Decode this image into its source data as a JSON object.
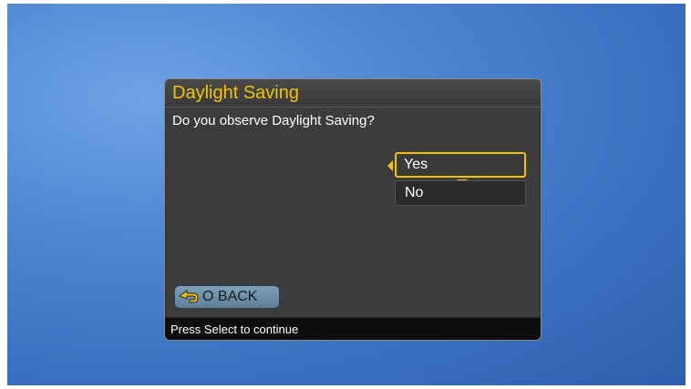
{
  "dialog": {
    "title": "Daylight Saving",
    "question": "Do you observe Daylight Saving?",
    "options": [
      {
        "label": "Yes",
        "selected": true
      },
      {
        "label": "No",
        "selected": false
      }
    ],
    "back_button_label": "O BACK",
    "status_text": "Press Select to continue"
  },
  "colors": {
    "accent": "#f2c200",
    "panel": "#3c3c3c",
    "status_bar": "#0e0e0e",
    "background": "#4f86d2"
  },
  "icons": {
    "back": "back-arrow-icon",
    "left_indicator": "left-arrow-icon",
    "down_indicator": "down-arrow-icon"
  }
}
